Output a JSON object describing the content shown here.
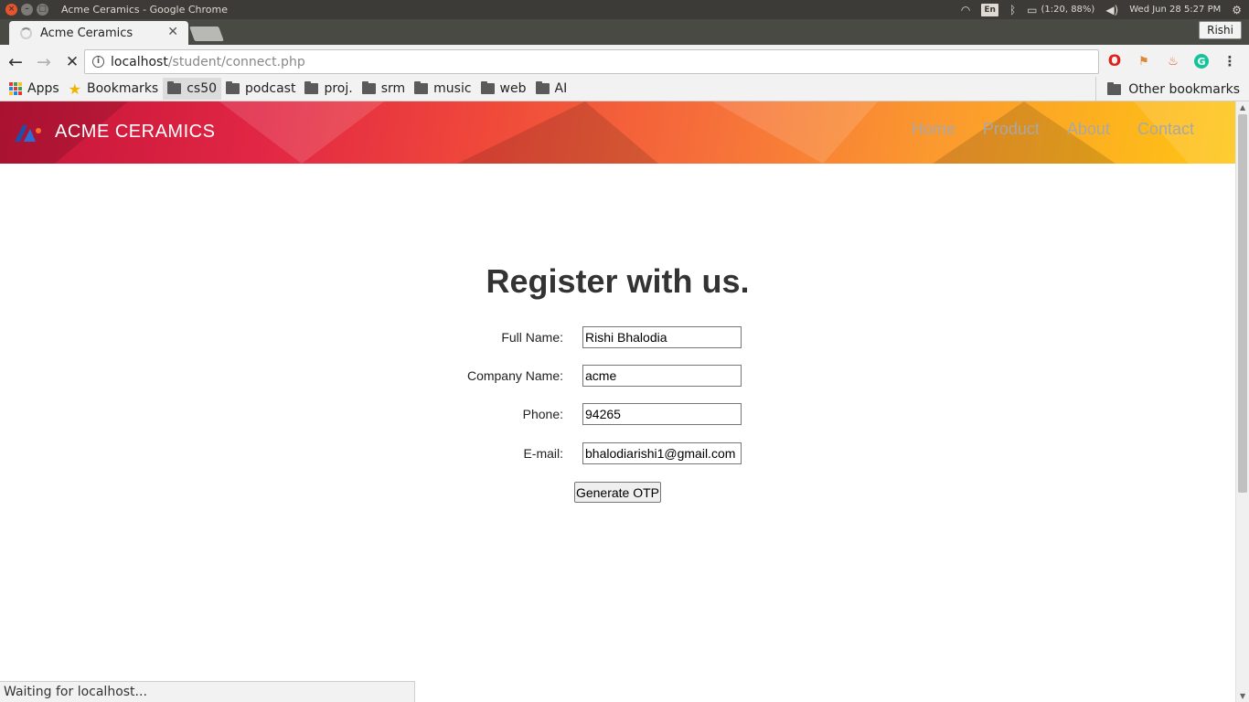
{
  "os": {
    "window_title": "Acme Ceramics - Google Chrome",
    "lang": "En",
    "battery": "(1:20, 88%)",
    "datetime": "Wed Jun 28  5:27 PM"
  },
  "browser": {
    "tab_title": "Acme Ceramics",
    "profile": "Rishi",
    "url_host": "localhost",
    "url_path": "/student/connect.php",
    "bookmarks": {
      "apps": "Apps",
      "bookmarks": "Bookmarks",
      "folders": [
        "cs50",
        "podcast",
        "proj.",
        "srm",
        "music",
        "web",
        "AI"
      ],
      "other": "Other bookmarks"
    },
    "status": "Waiting for localhost..."
  },
  "site": {
    "brand": "ACME CERAMICS",
    "nav": [
      "Home",
      "Product",
      "About",
      "Contact"
    ],
    "form": {
      "title": "Register with us.",
      "fields": [
        {
          "label": "Full Name:",
          "value": "Rishi Bhalodia"
        },
        {
          "label": "Company Name:",
          "value": "acme"
        },
        {
          "label": "Phone:",
          "value": "94265"
        },
        {
          "label": "E-mail:",
          "value": "bhalodiarishi1@gmail.com"
        }
      ],
      "submit": "Generate OTP"
    }
  },
  "colors": {
    "header_start": "#c4143a",
    "header_end": "#fec612",
    "nav_link": "#a8a8a8"
  }
}
